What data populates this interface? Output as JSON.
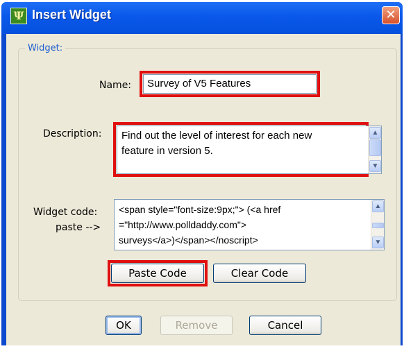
{
  "window": {
    "title": "Insert Widget",
    "app_icon_glyph": "Ψ",
    "close_glyph": "✕"
  },
  "group": {
    "legend": "Widget:"
  },
  "name": {
    "label": "Name:",
    "value": "Survey of V5 Features"
  },
  "description": {
    "label": "Description:",
    "lines": [
      "Find out the level of interest for each new",
      "feature in version 5."
    ]
  },
  "widget_code": {
    "label_line1": "Widget code:",
    "label_line2": "paste -->",
    "lines": [
      "<span style=\"font-size:9px;\"> (<a href",
      "=\"http://www.polldaddy.com\">",
      "surveys</a>)</span></noscript>"
    ]
  },
  "buttons": {
    "paste_code": "Paste Code",
    "clear_code": "Clear Code",
    "ok": "OK",
    "remove": "Remove",
    "cancel": "Cancel"
  },
  "icons": {
    "up": "▲",
    "down": "▼"
  },
  "colors": {
    "highlight": "#e01010",
    "titlebar": "#0a58ea",
    "group_legend": "#2160cf"
  }
}
